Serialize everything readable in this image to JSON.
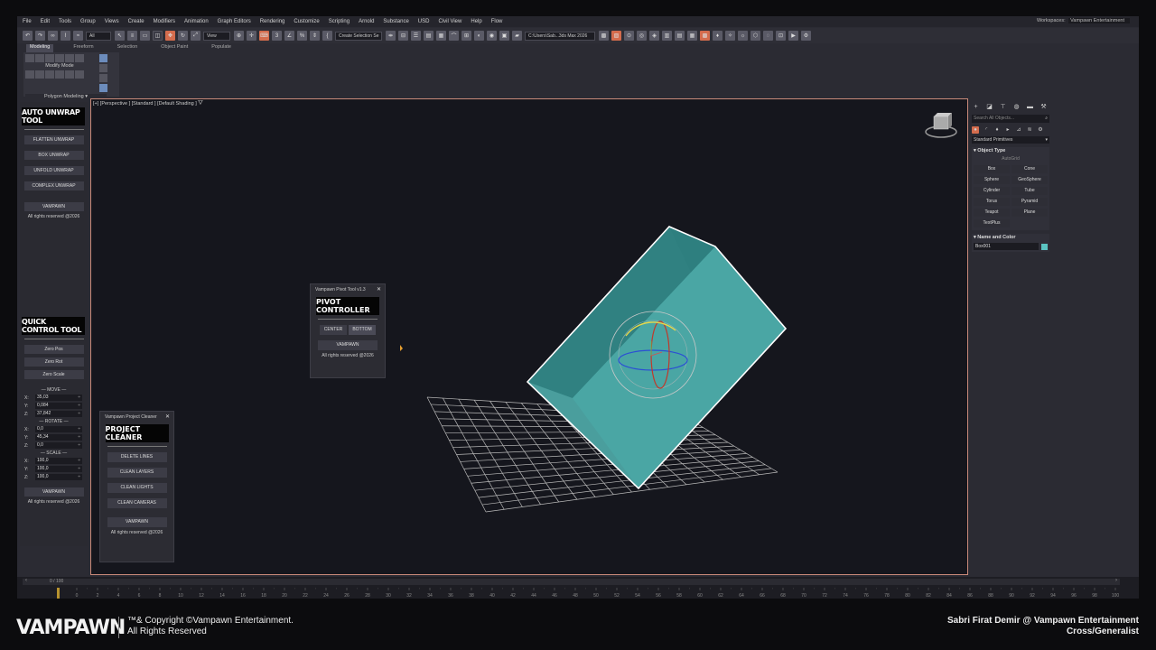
{
  "menu": {
    "items": [
      "File",
      "Edit",
      "Tools",
      "Group",
      "Views",
      "Create",
      "Modifiers",
      "Animation",
      "Graph Editors",
      "Rendering",
      "Customize",
      "Scripting",
      "Arnold",
      "Substance",
      "USD",
      "Civil View",
      "Help",
      "Flow"
    ],
    "workspace_label": "Workspaces:",
    "workspace_value": "Vampawn Entertainment"
  },
  "toolbar": {
    "filter": "All",
    "ref_coord": "View",
    "selection_set": "Create Selection Se",
    "project_path": "C:\\Users\\Sab...3ds Max 2026"
  },
  "ribbon": {
    "tabs": [
      "Modeling",
      "Freeform",
      "Selection",
      "Object Paint",
      "Populate"
    ],
    "mode": "Modify Mode",
    "polygon_modeling": "Polygon Modeling"
  },
  "auto_unwrap": {
    "title": "AUTO UNWRAP TOOL",
    "buttons": [
      "FLATTEN UNWRAP",
      "BOX UNWRAP",
      "UNFOLD UNWRAP",
      "COMPLEX UNWRAP"
    ],
    "brand": "VAMPAWN",
    "rights": "All rights reserved @2026"
  },
  "quick_control": {
    "title": "QUICK CONTROL TOOL",
    "buttons": [
      "Zero Pos",
      "Zero Rot",
      "Zero Scale"
    ],
    "move_label": "— MOVE —",
    "move": [
      {
        "k": "X:",
        "v": "35,03"
      },
      {
        "k": "Y:",
        "v": "0,084"
      },
      {
        "k": "Z:",
        "v": "37,842"
      }
    ],
    "rotate_label": "— ROTATE —",
    "rotate": [
      {
        "k": "X:",
        "v": "0,0"
      },
      {
        "k": "Y:",
        "v": "45,34"
      },
      {
        "k": "Z:",
        "v": "0,0"
      }
    ],
    "scale_label": "— SCALE —",
    "scale": [
      {
        "k": "X:",
        "v": "100,0"
      },
      {
        "k": "Y:",
        "v": "100,0"
      },
      {
        "k": "Z:",
        "v": "100,0"
      }
    ],
    "brand": "VAMPAWN",
    "rights": "All rights reserved @2026"
  },
  "viewport": {
    "label": "[+] [Perspective ] [Standard ] [Default Shading ]",
    "box_color": "#4a9e9d"
  },
  "pivot_tool": {
    "window_title": "Vampawn Pivot Tool v1.3",
    "title": "PIVOT CONTROLLER",
    "center": "CENTER",
    "bottom": "BOTTOM",
    "brand": "VAMPAWN",
    "rights": "All rights reserved @2026"
  },
  "project_cleaner": {
    "window_title": "Vampawn Project Cleaner",
    "title": "PROJECT CLEANER",
    "buttons": [
      "DELETE LINES",
      "CLEAN LAYERS",
      "CLEAN LIGHTS",
      "CLEAN CAMERAS"
    ],
    "brand": "VAMPAWN",
    "rights": "All rights reserved @2026"
  },
  "command_panel": {
    "search_placeholder": "Search All Objects...",
    "category": "Standard Primitives",
    "object_type_header": "Object Type",
    "autogrid": "AutoGrid",
    "primitives": [
      "Box",
      "Cone",
      "Sphere",
      "GeoSphere",
      "Cylinder",
      "Tube",
      "Torus",
      "Pyramid",
      "Teapot",
      "Plane",
      "TextPlus"
    ],
    "name_color_header": "Name and Color",
    "object_name": "Box001",
    "object_color": "#5bc4c2"
  },
  "timeline": {
    "frame_readout": "0 / 100",
    "ticks": [
      "0",
      "2",
      "4",
      "6",
      "8",
      "10",
      "12",
      "14",
      "16",
      "18",
      "20",
      "22",
      "24",
      "26",
      "28",
      "30",
      "32",
      "34",
      "36",
      "38",
      "40",
      "42",
      "44",
      "46",
      "48",
      "50",
      "52",
      "54",
      "56",
      "58",
      "60",
      "62",
      "64",
      "66",
      "68",
      "70",
      "72",
      "74",
      "76",
      "78",
      "80",
      "82",
      "84",
      "86",
      "88",
      "90",
      "92",
      "94",
      "96",
      "98",
      "100"
    ]
  },
  "footer": {
    "logo": "VAMPAWN",
    "copyright_line1": "™& Copyright ©Vampawn Entertainment.",
    "copyright_line2": "All Rights Reserved",
    "author_line1": "Sabri Firat Demir @ Vampawn Entertainment",
    "author_line2": "Cross/Generalist"
  }
}
